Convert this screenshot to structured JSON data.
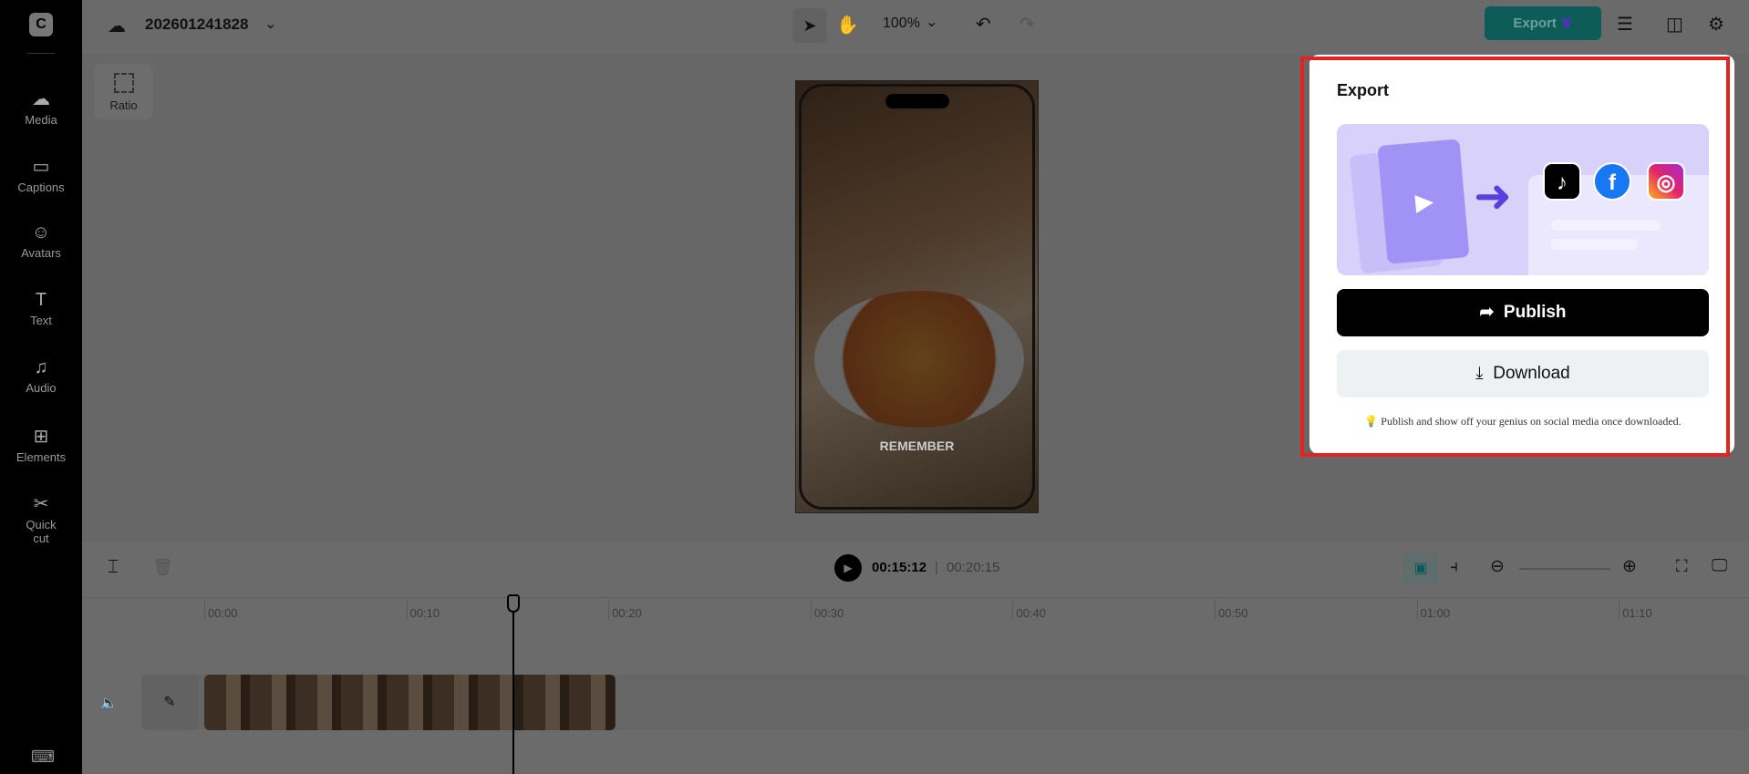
{
  "sidebar": {
    "items": [
      {
        "label": "Media",
        "icon": "cloud-upload-icon"
      },
      {
        "label": "Captions",
        "icon": "captions-icon"
      },
      {
        "label": "Avatars",
        "icon": "avatar-icon"
      },
      {
        "label": "Text",
        "icon": "text-icon"
      },
      {
        "label": "Audio",
        "icon": "music-icon"
      },
      {
        "label": "Elements",
        "icon": "elements-icon"
      },
      {
        "label": "Quick cut",
        "icon": "quick-cut-icon"
      }
    ]
  },
  "topbar": {
    "project_name": "202601241828",
    "zoom": "100%",
    "export_label": "Export"
  },
  "canvas": {
    "ratio_label": "Ratio",
    "caption": "REMEMBER"
  },
  "timeline": {
    "current_time": "00:15:12",
    "total_time": "00:20:15",
    "ruler": [
      "00:00",
      "00:10",
      "00:20",
      "00:30",
      "00:40",
      "00:50",
      "01:00",
      "01:10"
    ],
    "playhead_seconds": 15.4
  },
  "export_panel": {
    "title": "Export",
    "publish_label": "Publish",
    "download_label": "Download",
    "tip": "Publish and show off your genius on social media once downloaded.",
    "socials": [
      "TikTok",
      "Facebook",
      "Instagram"
    ]
  },
  "colors": {
    "accent": "#0f8f8f",
    "highlight": "#e52222",
    "publish_bg": "#000000"
  }
}
